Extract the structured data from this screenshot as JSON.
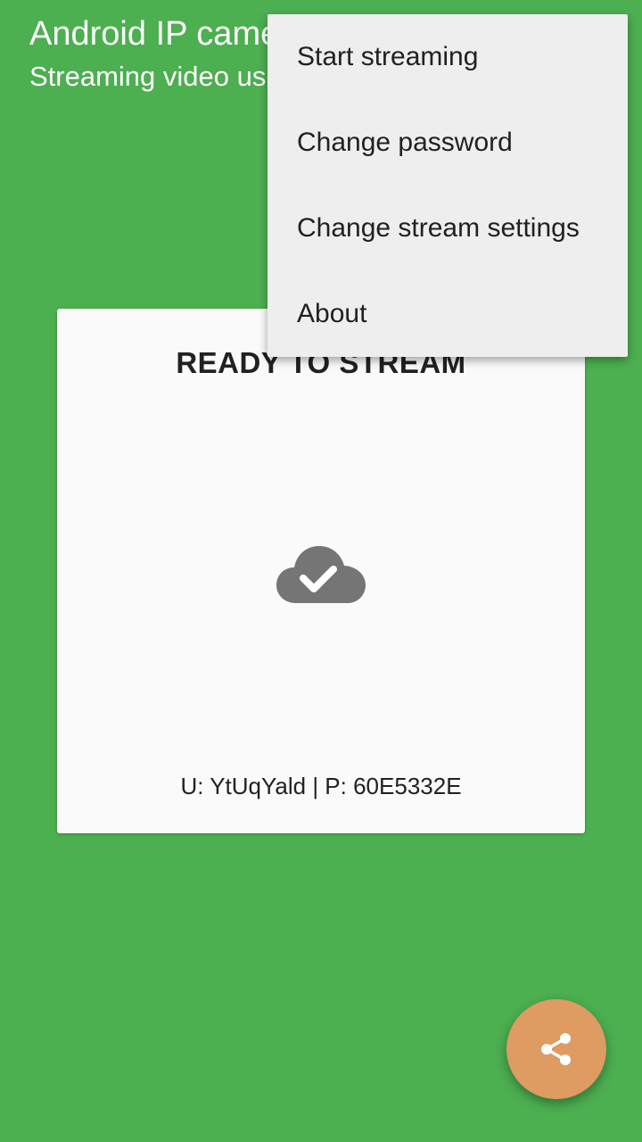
{
  "appbar": {
    "title": "Android IP camera",
    "subtitle": "Streaming video using your phone"
  },
  "card": {
    "status": "READY TO STREAM",
    "status_icon": "cloud-check-icon",
    "credentials": "U: YtUqYald | P: 60E5332E"
  },
  "menu": {
    "items": [
      {
        "label": "Start streaming"
      },
      {
        "label": "Change password"
      },
      {
        "label": "Change stream settings"
      },
      {
        "label": "About"
      }
    ]
  },
  "fab": {
    "icon": "share-icon"
  },
  "colors": {
    "background": "#4caf50",
    "card": "#fafafa",
    "menu": "#eeeeee",
    "fab": "#de9b62",
    "icon": "#757575"
  }
}
